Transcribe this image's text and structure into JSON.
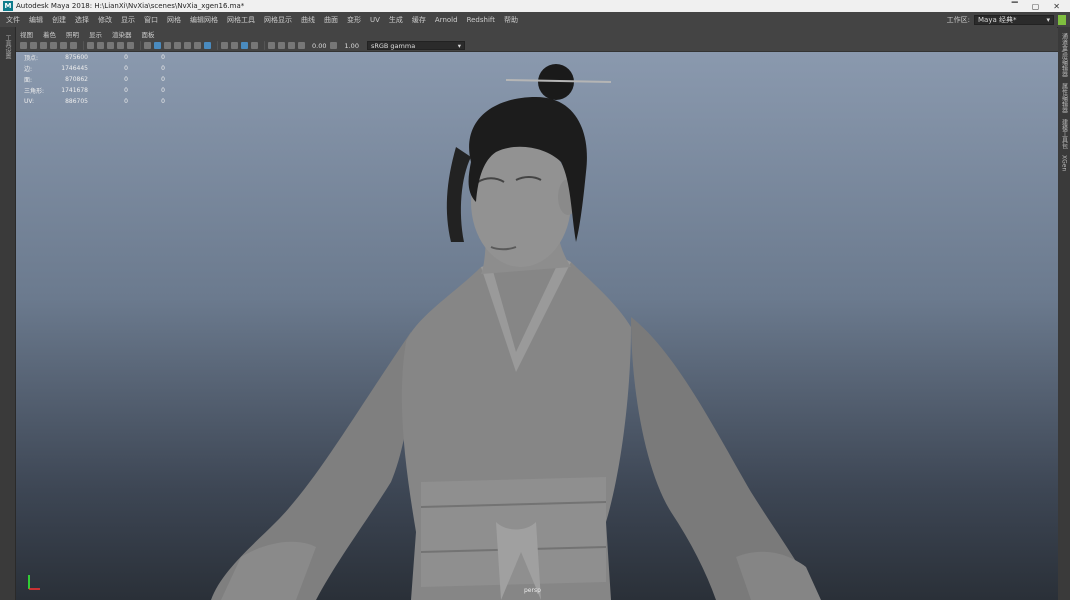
{
  "window": {
    "title": "Autodesk Maya 2018: H:\\LianXi\\NvXia\\scenes\\NvXia_xgen16.ma*",
    "logo": "M",
    "min_icon": "minimize-icon",
    "max_icon": "maximize-icon",
    "close_icon": "close-icon"
  },
  "menu": {
    "items": [
      "文件",
      "编辑",
      "创建",
      "选择",
      "修改",
      "显示",
      "窗口",
      "网格",
      "编辑网格",
      "网格工具",
      "网格显示",
      "曲线",
      "曲面",
      "变形",
      "UV",
      "生成",
      "缓存",
      "Arnold",
      "Redshift",
      "帮助"
    ],
    "workspace_label": "工作区:",
    "workspace_value": "Maya 经典*"
  },
  "left_panel": {
    "label": "工具设置"
  },
  "right_panel": {
    "labels": [
      "通道盒/层编辑器",
      "属性编辑器",
      "建模工具包",
      "XGen"
    ]
  },
  "panel_menu": {
    "items": [
      "视图",
      "着色",
      "照明",
      "显示",
      "渲染器",
      "面板"
    ]
  },
  "toolbar": {
    "exposure": "0.00",
    "gamma": "1.00",
    "color_space": "sRGB gamma"
  },
  "hud": {
    "rows": [
      [
        "顶点:",
        "875600",
        "0",
        "0"
      ],
      [
        "边:",
        "1746445",
        "0",
        "0"
      ],
      [
        "面:",
        "870862",
        "0",
        "0"
      ],
      [
        "三角形:",
        "1741678",
        "0",
        "0"
      ],
      [
        "UV:",
        "886705",
        "0",
        "0"
      ]
    ]
  },
  "viewport": {
    "camera": "persp"
  },
  "colors": {
    "accent": "#4a8bbf",
    "menu_bg": "#444444",
    "viewport_top": "#8a99ae",
    "viewport_bottom": "#2a3038"
  }
}
